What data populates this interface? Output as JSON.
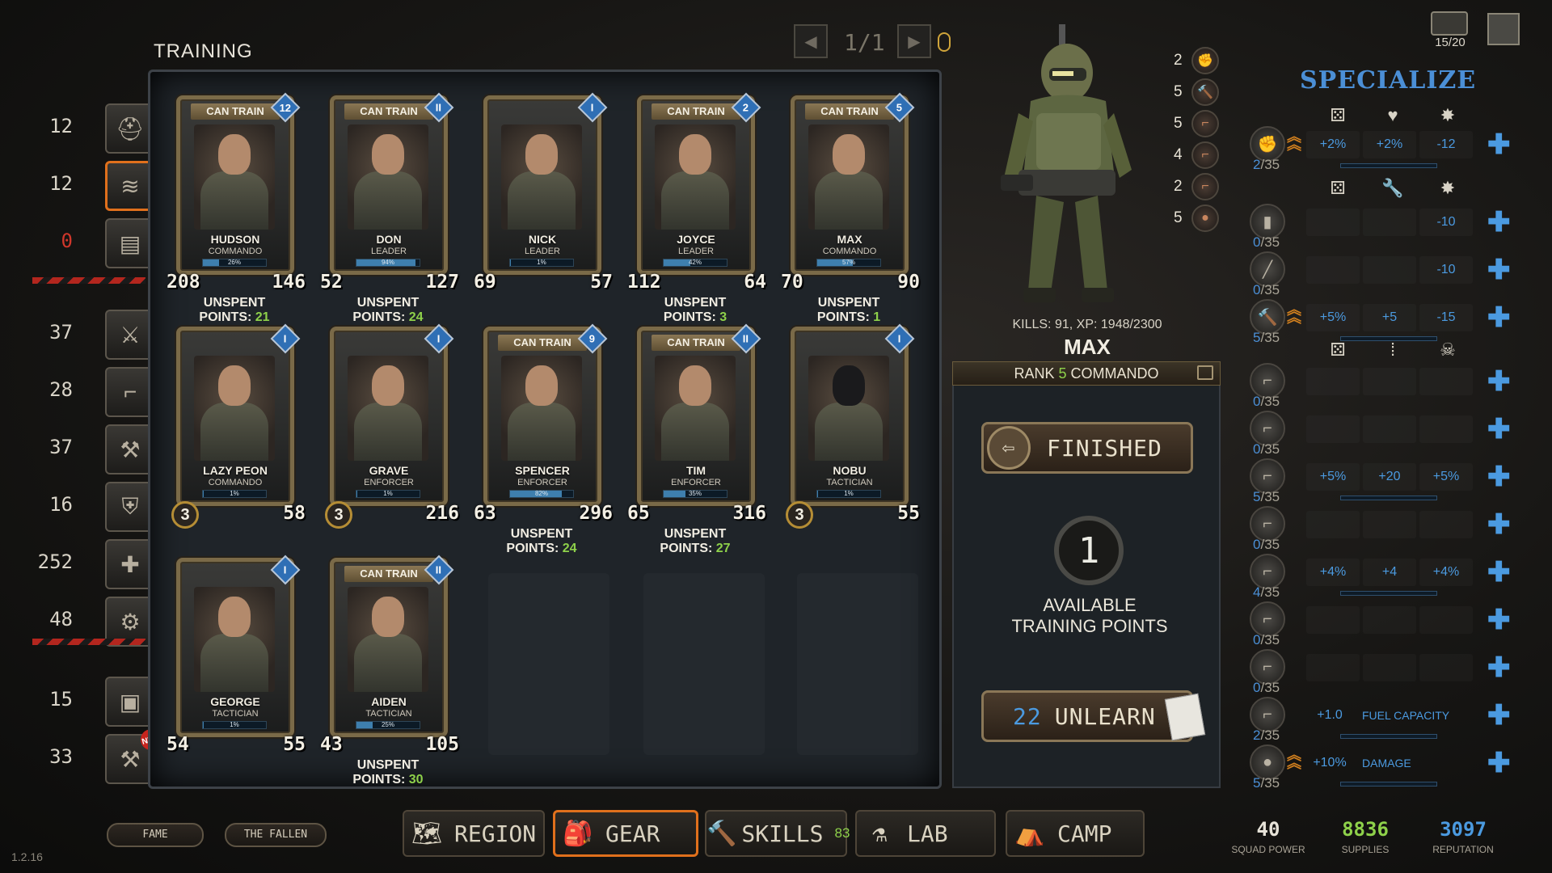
{
  "panel_title": "TRAINING",
  "version": "1.2.16",
  "pager": {
    "text": "1/1"
  },
  "vehicle_count": "15/20",
  "inventory": [
    {
      "count": "12",
      "icon": "helmet-icon",
      "red": false,
      "active": false
    },
    {
      "count": "12",
      "icon": "rank-chevron-icon",
      "red": false,
      "active": true
    },
    {
      "count": "0",
      "icon": "documents-icon",
      "red": true,
      "active": false
    },
    {
      "count": "37",
      "icon": "machete-icon",
      "red": false,
      "active": false
    },
    {
      "count": "28",
      "icon": "pistol-icon",
      "red": false,
      "active": false
    },
    {
      "count": "37",
      "icon": "drill-icon",
      "red": false,
      "active": false
    },
    {
      "count": "16",
      "icon": "vest-icon",
      "red": false,
      "active": false
    },
    {
      "count": "252",
      "icon": "medkit-icon",
      "red": false,
      "active": false
    },
    {
      "count": "48",
      "icon": "scrap-icon",
      "red": false,
      "active": false
    },
    {
      "count": "15",
      "icon": "crate-icon",
      "red": false,
      "active": false
    },
    {
      "count": "33",
      "icon": "tools-icon",
      "red": false,
      "active": false,
      "badge": "NEW"
    }
  ],
  "labels": {
    "can_train": "CAN TRAIN",
    "unspent": "UNSPENT",
    "points": "POINTS:"
  },
  "soldiers": [
    {
      "name": "HUDSON",
      "class": "COMMANDO",
      "xp": "26%",
      "xp_frac": 0.26,
      "rank": "12",
      "can_train": true,
      "left": "208",
      "right": "146",
      "unspent": "21"
    },
    {
      "name": "DON",
      "class": "LEADER",
      "xp": "94%",
      "xp_frac": 0.94,
      "rank": "II",
      "can_train": true,
      "left": "52",
      "right": "127",
      "unspent": "24"
    },
    {
      "name": "NICK",
      "class": "LEADER",
      "xp": "1%",
      "xp_frac": 0.01,
      "rank": "I",
      "can_train": false,
      "left": "69",
      "right": "57",
      "unspent": ""
    },
    {
      "name": "JOYCE",
      "class": "LEADER",
      "xp": "42%",
      "xp_frac": 0.42,
      "rank": "2",
      "can_train": true,
      "left": "112",
      "right": "64",
      "unspent": "3"
    },
    {
      "name": "MAX",
      "class": "COMMANDO",
      "xp": "57%",
      "xp_frac": 0.57,
      "rank": "5",
      "can_train": true,
      "left": "70",
      "right": "90",
      "unspent": "1"
    },
    {
      "name": "LAZY PEON",
      "class": "COMMANDO",
      "xp": "1%",
      "xp_frac": 0.01,
      "rank": "I",
      "can_train": false,
      "left": "3",
      "right": "58",
      "unspent": "",
      "left_circle": true
    },
    {
      "name": "GRAVE",
      "class": "ENFORCER",
      "xp": "1%",
      "xp_frac": 0.01,
      "rank": "I",
      "can_train": false,
      "left": "3",
      "right": "216",
      "unspent": "",
      "left_circle": true
    },
    {
      "name": "SPENCER",
      "class": "ENFORCER",
      "xp": "82%",
      "xp_frac": 0.82,
      "rank": "9",
      "can_train": true,
      "left": "63",
      "right": "296",
      "unspent": "24"
    },
    {
      "name": "TIM",
      "class": "ENFORCER",
      "xp": "35%",
      "xp_frac": 0.35,
      "rank": "II",
      "can_train": true,
      "left": "65",
      "right": "316",
      "unspent": "27"
    },
    {
      "name": "NOBU",
      "class": "TACTICIAN",
      "xp": "1%",
      "xp_frac": 0.01,
      "rank": "I",
      "can_train": false,
      "left": "3",
      "right": "55",
      "unspent": "",
      "left_circle": true,
      "masked": true
    },
    {
      "name": "GEORGE",
      "class": "TACTICIAN",
      "xp": "1%",
      "xp_frac": 0.01,
      "rank": "I",
      "can_train": false,
      "left": "54",
      "right": "55",
      "unspent": ""
    },
    {
      "name": "AIDEN",
      "class": "TACTICIAN",
      "xp": "25%",
      "xp_frac": 0.25,
      "rank": "II",
      "can_train": true,
      "left": "43",
      "right": "105",
      "unspent": "30"
    }
  ],
  "detail": {
    "kills_label": "KILLS:",
    "kills": "91",
    "xp_label": "XP:",
    "xp": "1948",
    "xp_max": "/2300",
    "name": "MAX",
    "rank_word": "RANK",
    "rank_num": "5",
    "rank_class": "COMMANDO",
    "finished_label": "FINISHED",
    "available_points": "1",
    "available_label_1": "AVAILABLE",
    "available_label_2": "TRAINING POINTS",
    "unlearn_cost": "22",
    "unlearn_label": "UNLEARN"
  },
  "skill_stacks": [
    {
      "n": "2",
      "icon": "fist-icon"
    },
    {
      "n": "5",
      "icon": "hammer-icon"
    },
    {
      "n": "5",
      "icon": "rifle-icon"
    },
    {
      "n": "4",
      "icon": "shotgun-icon"
    },
    {
      "n": "2",
      "icon": "smg-icon"
    },
    {
      "n": "5",
      "icon": "grenade-icon"
    }
  ],
  "specialize": {
    "title": "SPECIALIZE",
    "header_rows": [
      {
        "icons": [
          "dice-icon",
          "heart-icon",
          "burst-icon"
        ],
        "glyphs": [
          "⚄",
          "♥",
          "✸"
        ]
      },
      {
        "icons": [
          "dice-icon",
          "wrench-icon",
          "burst-icon"
        ],
        "glyphs": [
          "⚄",
          "🔧",
          "✸"
        ]
      },
      {
        "icons": [
          "dice-icon",
          "ammo-icon",
          "skull-icon"
        ],
        "glyphs": [
          "⚄",
          "⁞",
          "☠"
        ]
      }
    ],
    "rows": [
      {
        "icon": "fist-icon",
        "cur": "2",
        "max": "/35",
        "arrow": true,
        "cells": [
          "+2%",
          "+2%",
          "-12"
        ],
        "bar": true
      },
      {
        "icon": "fridge-icon",
        "cur": "0",
        "max": "/35",
        "arrow": false,
        "cells": [
          "",
          "",
          "-10"
        ],
        "bar": false
      },
      {
        "icon": "crowbar-icon",
        "cur": "0",
        "max": "/35",
        "arrow": false,
        "cells": [
          "",
          "",
          "-10"
        ],
        "bar": false
      },
      {
        "icon": "hammer-icon",
        "cur": "5",
        "max": "/35",
        "arrow": true,
        "cells": [
          "+5%",
          "+5",
          "-15"
        ],
        "bar": true
      },
      {
        "icon": "revolver-icon",
        "cur": "0",
        "max": "/35",
        "arrow": false,
        "cells": [
          "",
          "",
          ""
        ],
        "bar": false
      },
      {
        "icon": "pistol-icon",
        "cur": "0",
        "max": "/35",
        "arrow": false,
        "cells": [
          "",
          "",
          ""
        ],
        "bar": false
      },
      {
        "icon": "rifle-icon",
        "cur": "5",
        "max": "/35",
        "arrow": false,
        "cells": [
          "+5%",
          "+20",
          "+5%"
        ],
        "bar": true
      },
      {
        "icon": "smg-icon",
        "cur": "0",
        "max": "/35",
        "arrow": false,
        "cells": [
          "",
          "",
          ""
        ],
        "bar": false
      },
      {
        "icon": "shotgun-icon",
        "cur": "4",
        "max": "/35",
        "arrow": false,
        "cells": [
          "+4%",
          "+4",
          "+4%"
        ],
        "bar": true
      },
      {
        "icon": "launcher-icon",
        "cur": "0",
        "max": "/35",
        "arrow": false,
        "cells": [
          "",
          "",
          ""
        ],
        "bar": false
      },
      {
        "icon": "sniper-icon",
        "cur": "0",
        "max": "/35",
        "arrow": false,
        "cells": [
          "",
          "",
          ""
        ],
        "bar": false
      },
      {
        "icon": "flamethrower-icon",
        "cur": "2",
        "max": "/35",
        "arrow": false,
        "cells": [
          "+1.0"
        ],
        "wide": "FUEL CAPACITY",
        "bar": true
      },
      {
        "icon": "grenade-icon",
        "cur": "5",
        "max": "/35",
        "arrow": true,
        "cells": [
          "+10%"
        ],
        "wide": "DAMAGE",
        "bar": true
      }
    ]
  },
  "bottom": {
    "fame": "FAME",
    "fallen": "THE FALLEN",
    "tabs": [
      {
        "label": "REGION",
        "icon": "map-icon",
        "glyph": "🗺",
        "active": false
      },
      {
        "label": "GEAR",
        "icon": "backpack-icon",
        "glyph": "🎒",
        "active": true
      },
      {
        "label": "SKILLS",
        "icon": "hammer-icon",
        "glyph": "🔨",
        "active": false,
        "badge": "83"
      },
      {
        "label": "LAB",
        "icon": "flask-icon",
        "glyph": "⚗",
        "active": false
      },
      {
        "label": "CAMP",
        "icon": "camp-icon",
        "glyph": "⛺",
        "active": false
      }
    ],
    "stats": [
      {
        "value": "40",
        "label": "SQUAD POWER",
        "color": "#e6e2d8"
      },
      {
        "value": "8836",
        "label": "SUPPLIES",
        "color": "#8ed14a"
      },
      {
        "value": "3097",
        "label": "REPUTATION",
        "color": "#4b9ae0"
      }
    ]
  },
  "colors": {
    "accent_orange": "#e0701c",
    "green": "#8ed14a",
    "blue": "#4b9ae0",
    "red": "#d0372b"
  }
}
